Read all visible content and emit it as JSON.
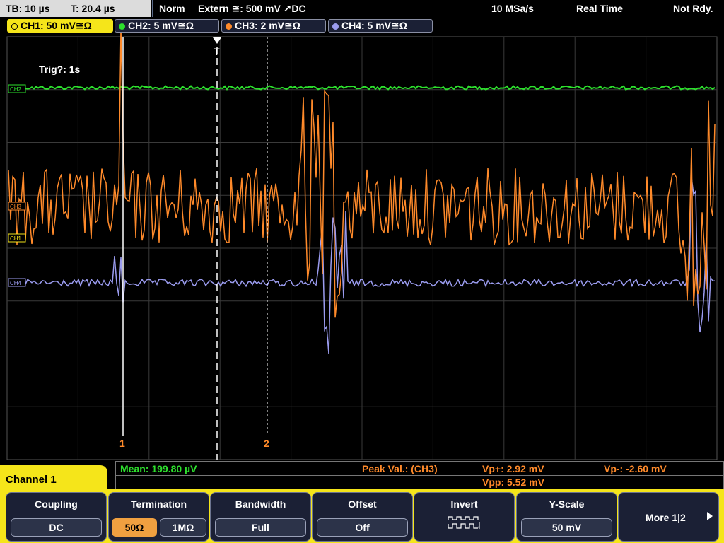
{
  "status": {
    "timebase": "TB: 10 µs",
    "trigger_pos": "T: 20.4 µs",
    "mode": "Norm",
    "trigger_source": "Extern ≅: 500 mV ↗DC",
    "sample_rate": "10 MSa/s",
    "acq_mode": "Real Time",
    "state": "Not Rdy."
  },
  "channels": [
    {
      "label": "CH1: 50 mV≅Ω",
      "color": "#f5e51a",
      "active": true
    },
    {
      "label": "CH2: 5 mV≅Ω",
      "color": "#2de02d",
      "active": false
    },
    {
      "label": "CH3: 2 mV≅Ω",
      "color": "#ff8a2a",
      "active": false
    },
    {
      "label": "CH4: 5 mV≅Ω",
      "color": "#9b9cf0",
      "active": false
    }
  ],
  "screen": {
    "trig_message": "Trig?: 1s",
    "trigger_marker": "T",
    "cursor1_label": "1",
    "cursor2_label": "2",
    "ch2_marker": "CH2",
    "ch3_marker": "CH3",
    "ch1_marker": "CH1",
    "ch4_marker": "CH4"
  },
  "readout": {
    "mean": "Mean: 199.80 µV",
    "peak": "Peak Val.: (CH3)",
    "vp_plus": "Vp+: 2.92 mV",
    "vp_minus": "Vp-: -2.60 mV",
    "vpp": "Vpp: 5.52 mV"
  },
  "menu_title": "Channel 1",
  "softkeys": {
    "coupling": {
      "title": "Coupling",
      "value": "DC"
    },
    "termination": {
      "title": "Termination",
      "opt1": "50Ω",
      "opt2": "1MΩ"
    },
    "bandwidth": {
      "title": "Bandwidth",
      "value": "Full"
    },
    "offset": {
      "title": "Offset",
      "value": "Off"
    },
    "invert": {
      "title": "Invert"
    },
    "yscale": {
      "title": "Y-Scale",
      "value": "50 mV"
    },
    "more": {
      "label": "More 1|2"
    }
  },
  "colors": {
    "ch1": "#f5e51a",
    "ch2": "#2de02d",
    "ch3": "#ff8a2a",
    "ch4": "#9b9cf0",
    "menu_bg": "#1b2035"
  }
}
